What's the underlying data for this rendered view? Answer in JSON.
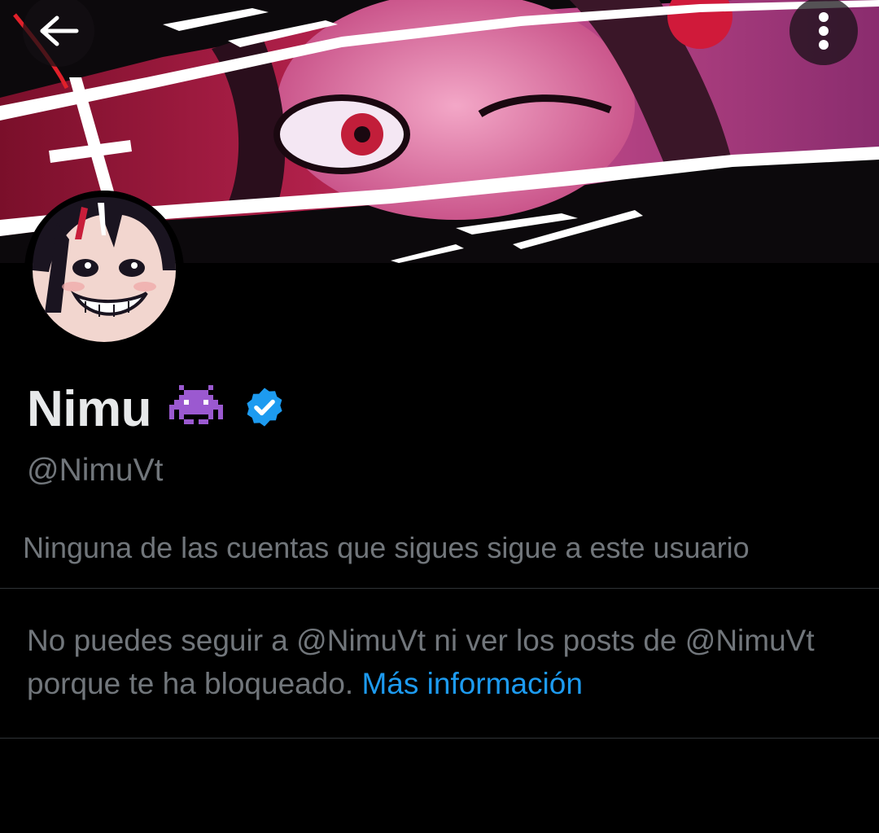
{
  "header": {
    "back_icon": "arrow-left-icon",
    "more_icon": "more-vertical-icon"
  },
  "profile": {
    "display_name": "Nimu",
    "name_emoji": "alien-monster-emoji",
    "verified_icon": "verified-badge-icon",
    "handle": "@NimuVt",
    "followers_note": "Ninguna de las cuentas que sigues sigue a este usuario"
  },
  "blocked": {
    "message": "No puedes seguir a @NimuVt ni ver los posts de @NimuVt porque te ha bloqueado.",
    "link_label": "Más información"
  },
  "colors": {
    "background": "#000000",
    "primary_text": "#e7e9ea",
    "secondary_text": "#71767b",
    "link": "#1d9bf0",
    "divider": "#2f3336",
    "verified": "#1d9bf0",
    "emoji": "#9b59d0"
  }
}
